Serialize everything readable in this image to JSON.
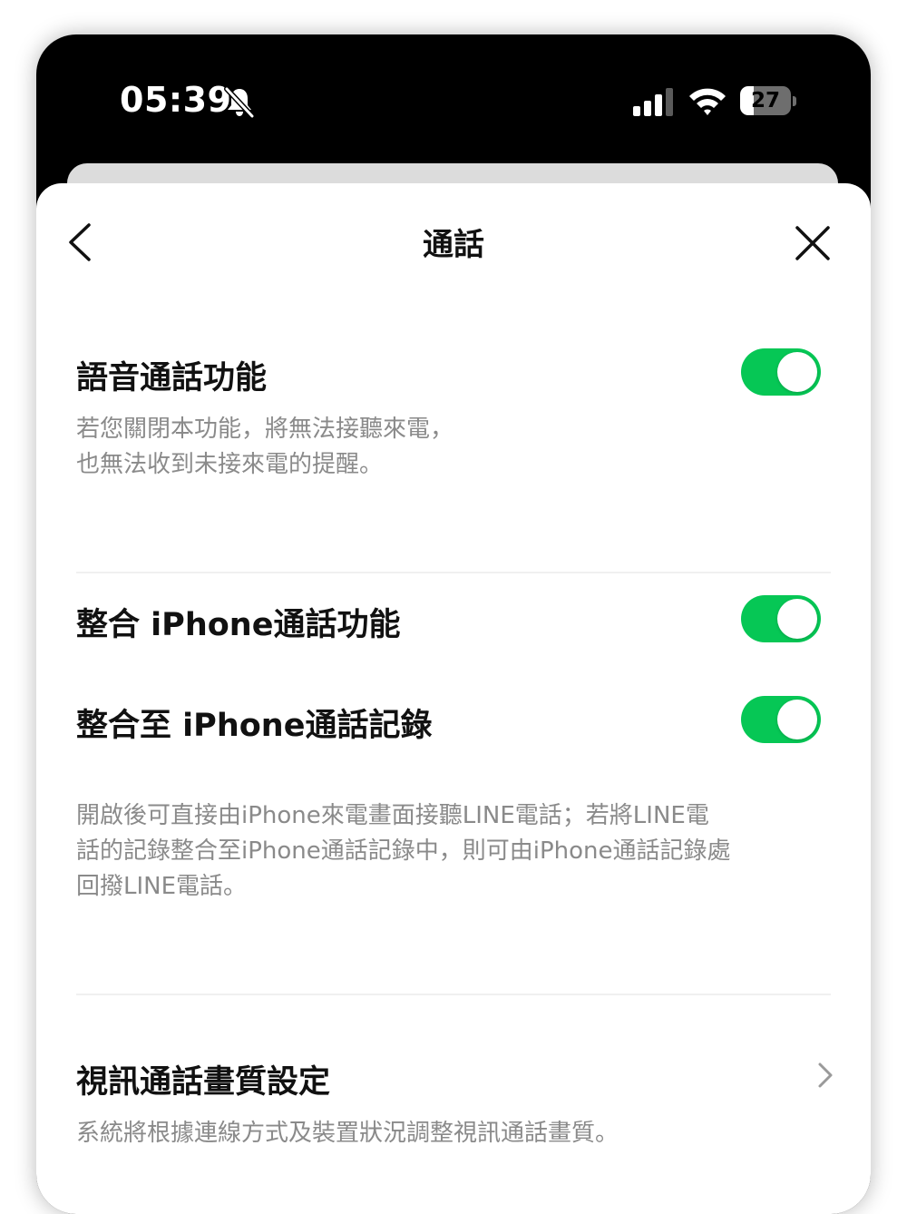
{
  "status_bar": {
    "time": "05:39",
    "battery_level": "27",
    "icons": [
      "bell-off-icon",
      "cellular-signal-icon",
      "wifi-icon",
      "battery-icon"
    ]
  },
  "nav": {
    "title": "通話",
    "back_icon": "chevron-left-icon",
    "close_icon": "close-icon"
  },
  "settings": {
    "voice_call": {
      "title": "語音通話功能",
      "description_line1": "若您關閉本功能，將無法接聽來電，",
      "description_line2": "也無法收到未接來電的提醒。",
      "enabled": true
    },
    "integrate_iphone_call": {
      "title": "整合 iPhone通話功能",
      "enabled": true
    },
    "integrate_iphone_log": {
      "title": "整合至 iPhone通話記錄",
      "enabled": true
    },
    "integrate_description": {
      "line1": "開啟後可直接由iPhone來電畫面接聽LINE電話；若將LINE電",
      "line2": "話的記錄整合至iPhone通話記錄中，則可由iPhone通話記錄處",
      "line3": "回撥LINE電話。"
    },
    "video_quality": {
      "title": "視訊通話畫質設定",
      "description": "系統將根據連線方式及裝置狀況調整視訊通話畫質。",
      "icon": "chevron-right-icon"
    }
  },
  "colors": {
    "toggle_on": "#06c755",
    "text_primary": "#111111",
    "text_secondary": "#8a8a8a",
    "divider": "#f0f0f0"
  }
}
